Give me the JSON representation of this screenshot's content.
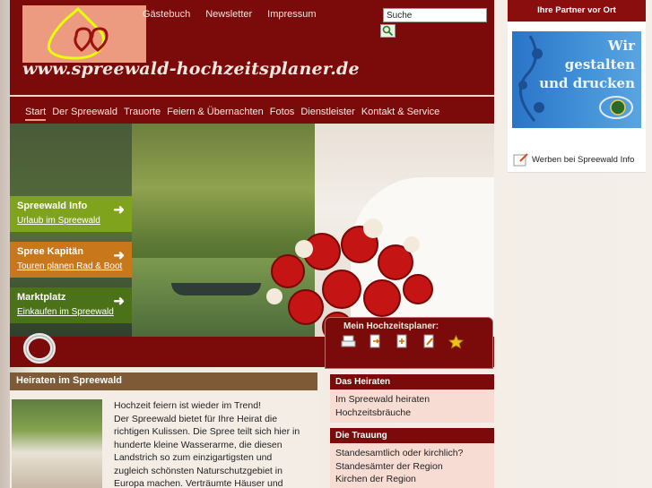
{
  "header": {
    "logo_url": "www.spreewald-hochzeitsplaner.de",
    "top_nav": [
      "Gästebuch",
      "Newsletter",
      "Impressum"
    ],
    "search_value": "Suche"
  },
  "main_nav": [
    "Start",
    "Der Spreewald",
    "Trauorte",
    "Feiern & Übernachten",
    "Fotos",
    "Dienstleister",
    "Kontakt & Service"
  ],
  "promos": [
    {
      "title": "Spreewald Info",
      "sub": "Urlaub im Spreewald",
      "color": "#7fa31c"
    },
    {
      "title": "Spree Kapitän",
      "sub": "Touren planen Rad & Boot",
      "color": "#c8781a"
    },
    {
      "title": "Marktplatz",
      "sub": "Einkaufen im Spreewald",
      "color": "#4b7219"
    }
  ],
  "planer": {
    "title": "Mein Hochzeitsplaner:",
    "icons": [
      "print-icon",
      "export-icon",
      "add-page-icon",
      "edit-icon",
      "star-icon"
    ]
  },
  "content": {
    "title": "Heiraten im Spreewald",
    "lines": [
      "Hochzeit feiern ist wieder im Trend!",
      "Der Spreewald bietet für Ihre Heirat die",
      "richtigen Kulissen. Die Spree teilt sich hier in",
      "hunderte kleine Wasserarme, die diesen",
      "Landstrich so zum einzigartigsten und",
      "zugleich schönsten Naturschutzgebiet in",
      "Europa machen. Verträumte Häuser und"
    ]
  },
  "rail": [
    {
      "title": "Das Heiraten",
      "links": [
        "Im Spreewald heiraten",
        "Hochzeitsbräuche"
      ]
    },
    {
      "title": "Die Trauung",
      "links": [
        "Standesamtlich oder kirchlich?",
        "Standesämter der Region",
        "Kirchen der Region"
      ]
    }
  ],
  "sidebar": {
    "title": "Ihre Partner vor Ort",
    "ad_lines": [
      "Wir",
      "gestalten",
      "und drucken"
    ],
    "ad_link": "Werben bei Spreewald Info"
  },
  "colors": {
    "brand": "#7b0a0a",
    "accent": "#ec9a80"
  }
}
